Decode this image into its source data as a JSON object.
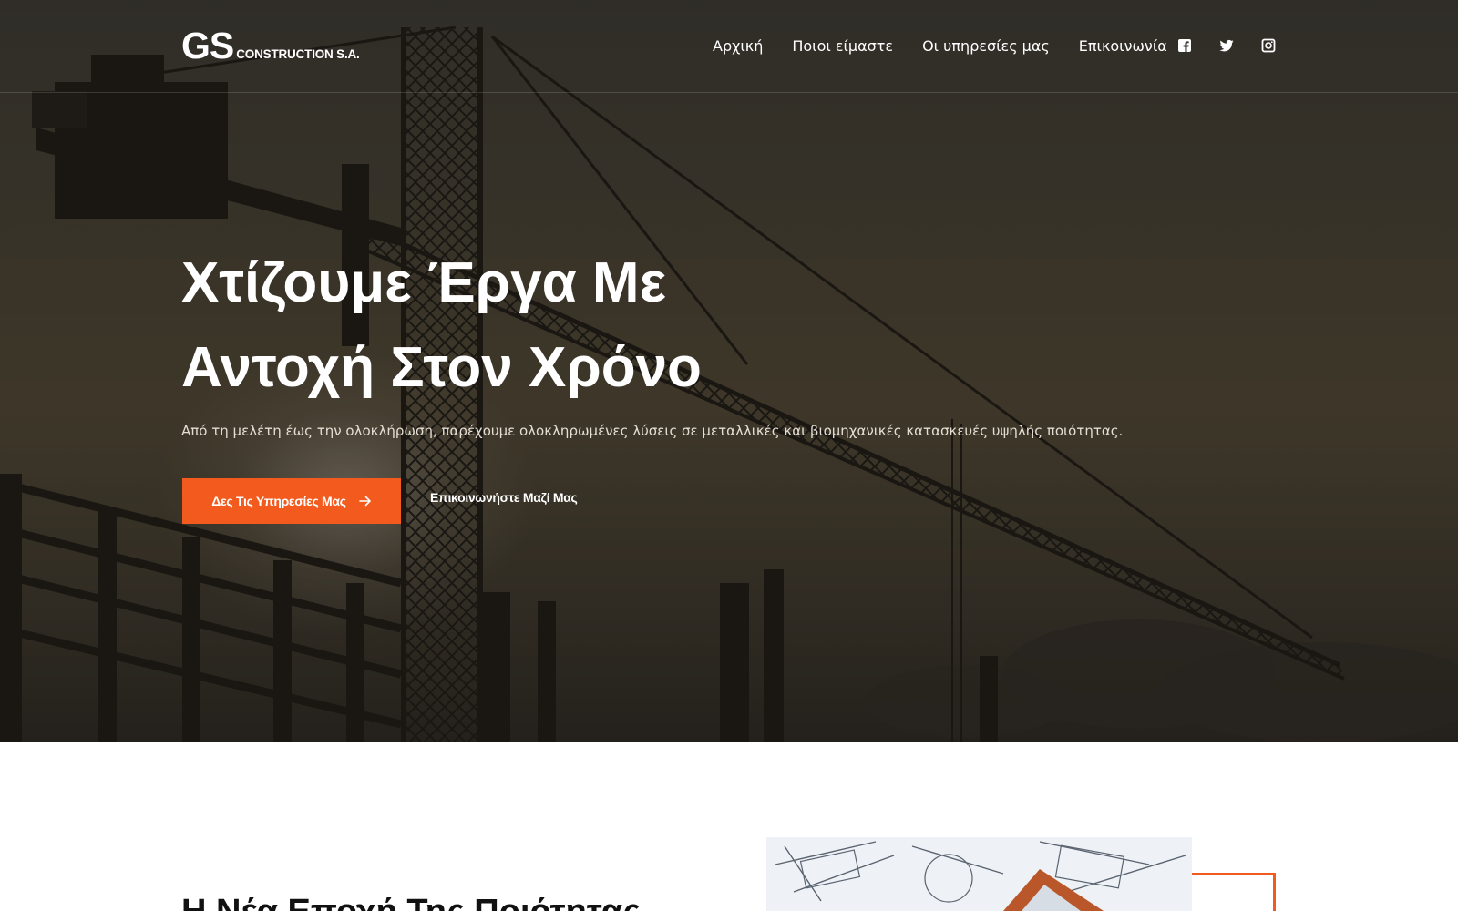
{
  "brand": {
    "mark": "GS",
    "name": "CONSTRUCTION S.A.",
    "accent_color": "#f35b1e"
  },
  "nav": {
    "items": [
      {
        "label": "Αρχική"
      },
      {
        "label": "Ποιοι είμαστε"
      },
      {
        "label": "Οι υπηρεσίες μας"
      },
      {
        "label": "Επικοινωνία"
      }
    ],
    "social": [
      {
        "icon": "facebook-icon"
      },
      {
        "icon": "twitter-icon"
      },
      {
        "icon": "instagram-icon"
      }
    ]
  },
  "hero": {
    "title_line1": "Χτίζουμε Έργα Με",
    "title_line2": "Αντοχή Στον Χρόνο",
    "subtitle": "Από τη μελέτη έως την ολοκλήρωση, παρέχουμε ολοκληρωμένες λύσεις σε μεταλλικές και βιομηχανικές κατασκευές υψηλής ποιότητας.",
    "primary_button": "Δες Τις Υπηρεσίες Μας",
    "primary_icon": "arrow-right-icon",
    "secondary_button": "Επικοινωνήστε Μαζί Μας"
  },
  "about": {
    "title": "Η Νέα Εποχή Της Ποιότητας"
  }
}
